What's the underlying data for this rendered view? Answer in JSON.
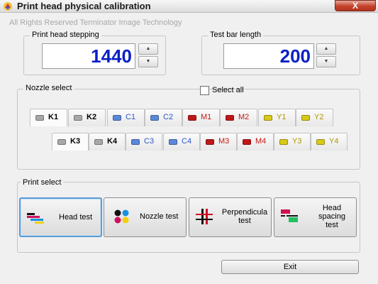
{
  "window": {
    "title": "Print head physical calibration",
    "close_label": "X",
    "copyright": "All Rights Reserved Terminator Image Technology"
  },
  "stepping": {
    "group_label": "Print head stepping",
    "value": "1440",
    "up_icon": "triangle-up-icon",
    "down_icon": "triangle-down-icon"
  },
  "test_bar": {
    "group_label": "Test bar length",
    "value": "200"
  },
  "nozzle": {
    "group_label": "Nozzle select",
    "select_all_label": "Select all",
    "select_all_checked": false,
    "colors": {
      "grey": "#a8a8a8",
      "blue": "#5b88d8",
      "red": "#c01818",
      "yellow": "#d9c918"
    },
    "text_colors": {
      "grey": "#000000",
      "blue": "#2a56c8",
      "red": "#c81818",
      "yellow": "#b09800"
    },
    "row1": [
      {
        "label": "K1",
        "color": "grey"
      },
      {
        "label": "K2",
        "color": "grey"
      },
      {
        "label": "C1",
        "color": "blue"
      },
      {
        "label": "C2",
        "color": "blue"
      },
      {
        "label": "M1",
        "color": "red"
      },
      {
        "label": "M2",
        "color": "red"
      },
      {
        "label": "Y1",
        "color": "yellow"
      },
      {
        "label": "Y2",
        "color": "yellow"
      }
    ],
    "row2": [
      {
        "label": "K3",
        "color": "grey"
      },
      {
        "label": "K4",
        "color": "grey"
      },
      {
        "label": "C3",
        "color": "blue"
      },
      {
        "label": "C4",
        "color": "blue"
      },
      {
        "label": "M3",
        "color": "red"
      },
      {
        "label": "M4",
        "color": "red"
      },
      {
        "label": "Y3",
        "color": "yellow"
      },
      {
        "label": "Y4",
        "color": "yellow"
      }
    ]
  },
  "print_select": {
    "group_label": "Print select",
    "buttons": [
      {
        "label": "Head test",
        "icon": "head-test-icon"
      },
      {
        "label": "Nozzle test",
        "icon": "nozzle-test-icon"
      },
      {
        "label_line1": "Perpendicula",
        "label_line2": "test",
        "icon": "perpendicular-test-icon"
      },
      {
        "label_line1": "Head",
        "label_line2": "spacing",
        "label_line3": "test",
        "icon": "head-spacing-test-icon"
      }
    ]
  },
  "exit_label": "Exit"
}
